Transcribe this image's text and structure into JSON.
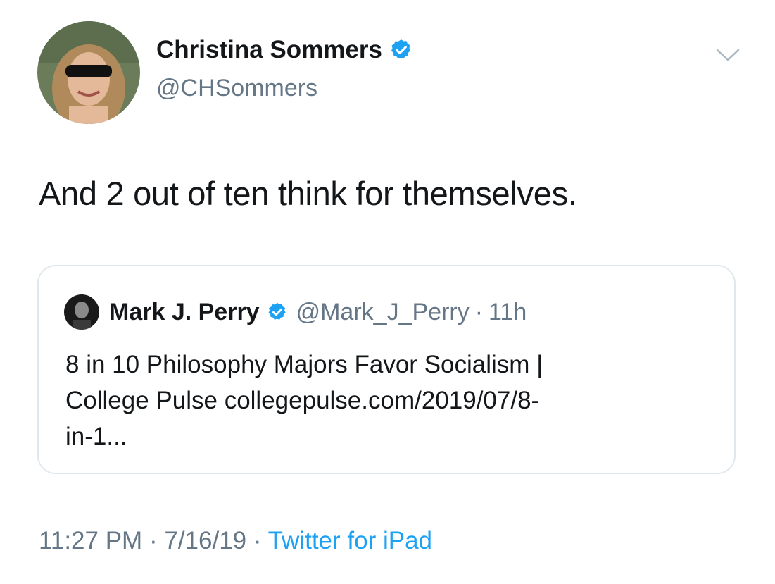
{
  "tweet": {
    "author": {
      "name": "Christina Sommers",
      "handle": "@CHSommers"
    },
    "text": "And 2 out of ten think for themselves.",
    "timestamp_time": "11:27 PM",
    "timestamp_date": "7/16/19",
    "separator": "·",
    "source": "Twitter for iPad"
  },
  "quoted_tweet": {
    "author": {
      "name": "Mark J. Perry",
      "handle": "@Mark_J_Perry"
    },
    "separator": "·",
    "time": "11h",
    "text_lines": [
      "8 in 10 Philosophy Majors Favor Socialism |",
      "College Pulse collegepulse.com/2019/07/8-",
      "in-1..."
    ]
  },
  "icons": {
    "verified": "verified-badge-icon",
    "menu": "chevron-down-icon"
  },
  "colors": {
    "link": "#1da1f2",
    "secondary_text": "#657786",
    "border": "#e1e8ed"
  }
}
